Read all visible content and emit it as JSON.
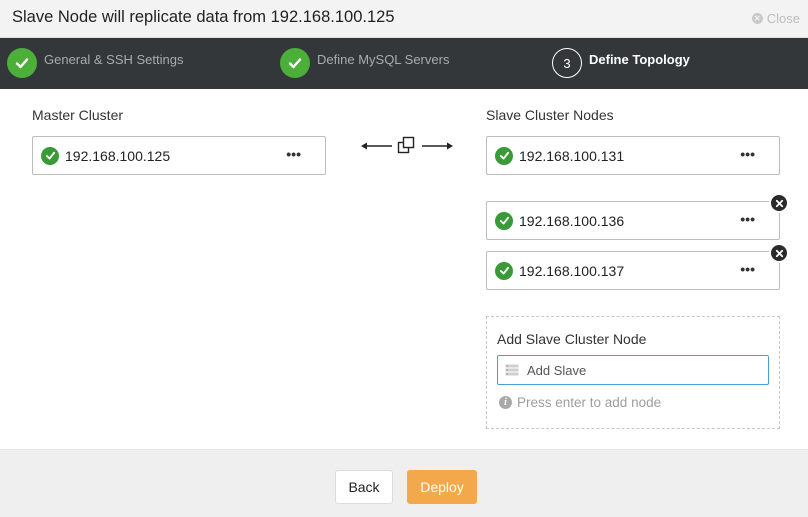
{
  "dialog": {
    "title": "Slave Node will replicate data from 192.168.100.125",
    "close_label": "Close"
  },
  "steps": [
    {
      "label": "General & SSH Settings",
      "status": "complete"
    },
    {
      "label": "Define MySQL Servers",
      "status": "complete"
    },
    {
      "number": "3",
      "label": "Define Topology",
      "status": "active"
    }
  ],
  "master": {
    "label": "Master Cluster",
    "nodes": [
      {
        "ip": "192.168.100.125",
        "menu": "•••"
      }
    ]
  },
  "slave": {
    "label": "Slave Cluster Nodes",
    "nodes": [
      {
        "ip": "192.168.100.131",
        "menu": "•••",
        "removable": false
      },
      {
        "ip": "192.168.100.136",
        "menu": "•••",
        "removable": true
      },
      {
        "ip": "192.168.100.137",
        "menu": "•••",
        "removable": true
      }
    ]
  },
  "add_slave": {
    "title": "Add Slave Cluster Node",
    "placeholder": "Add Slave",
    "hint": "Press enter to add node"
  },
  "footer": {
    "back_label": "Back",
    "deploy_label": "Deploy"
  },
  "colors": {
    "step_bar": "#33373a",
    "success": "#4caf3a",
    "deploy": "#f3a84b",
    "input_focus": "#4a9fd0"
  }
}
